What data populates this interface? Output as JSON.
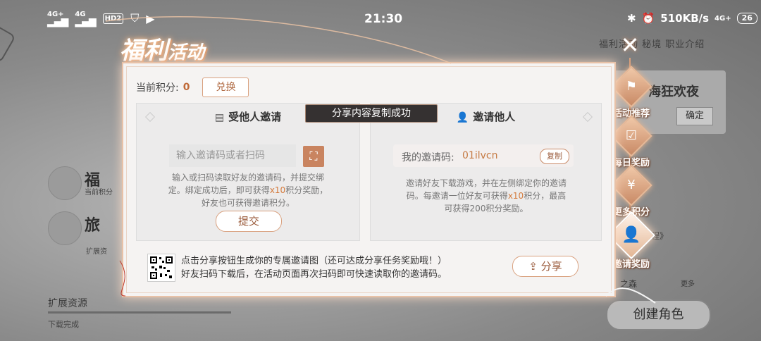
{
  "status_bar": {
    "signal_1": "4G+",
    "signal_2": "4G",
    "hd": "HD2",
    "time": "21:30",
    "speed": "510KB/s",
    "net": "4G+",
    "battery": "26"
  },
  "header": {
    "title_main": "福利",
    "title_sub": "活动"
  },
  "background": {
    "item1_title": "福",
    "item1_sub": "当前积分",
    "item2_title": "旅",
    "item2_sub": "扩展资",
    "expand_label": "扩展资源",
    "download_done": "下载完成",
    "carnival": "海狂欢夜",
    "confirm": "确定",
    "tabs_text": "福利活动  秘境  职业介绍",
    "journey": "的旅程》",
    "forest": "之森",
    "more": "更多",
    "create_role": "创建角色"
  },
  "side_tabs": [
    {
      "label": "活动推荐",
      "icon": "flag-icon"
    },
    {
      "label": "每日奖励",
      "icon": "calendar-icon"
    },
    {
      "label": "更多积分",
      "icon": "money-bag-icon"
    },
    {
      "label": "邀请奖励",
      "icon": "user-plus-icon"
    }
  ],
  "dialog": {
    "score_label": "当前积分:",
    "score_value": "0",
    "exchange_label": "兑换",
    "left_card": {
      "title": "受他人邀请",
      "placeholder": "输入邀请码或者扫码",
      "desc_1": "输入或扫码读取好友的邀请码，并提交绑定。绑定成功后，即可获得",
      "desc_reward": "x10",
      "desc_2": "积分奖励，好友也可获得邀请积分。",
      "submit_label": "提交"
    },
    "right_card": {
      "title": "邀请他人",
      "mycode_label": "我的邀请码:",
      "mycode_value": "01ilvcn",
      "copy_label": "复制",
      "desc_1": "邀请好友下载游戏，并在左侧绑定你的邀请码。每邀请一位好友可获得",
      "desc_reward": "x10",
      "desc_2": "积分，最高可获得200积分奖励。"
    },
    "toast": "分享内容复制成功",
    "share_line_1": "点击分享按钮生成你的专属邀请图（还可达成分享任务奖励哦！）",
    "share_line_2": "好友扫码下载后，在活动页面再次扫码即可快速读取你的邀请码。",
    "share_label": "分享"
  }
}
